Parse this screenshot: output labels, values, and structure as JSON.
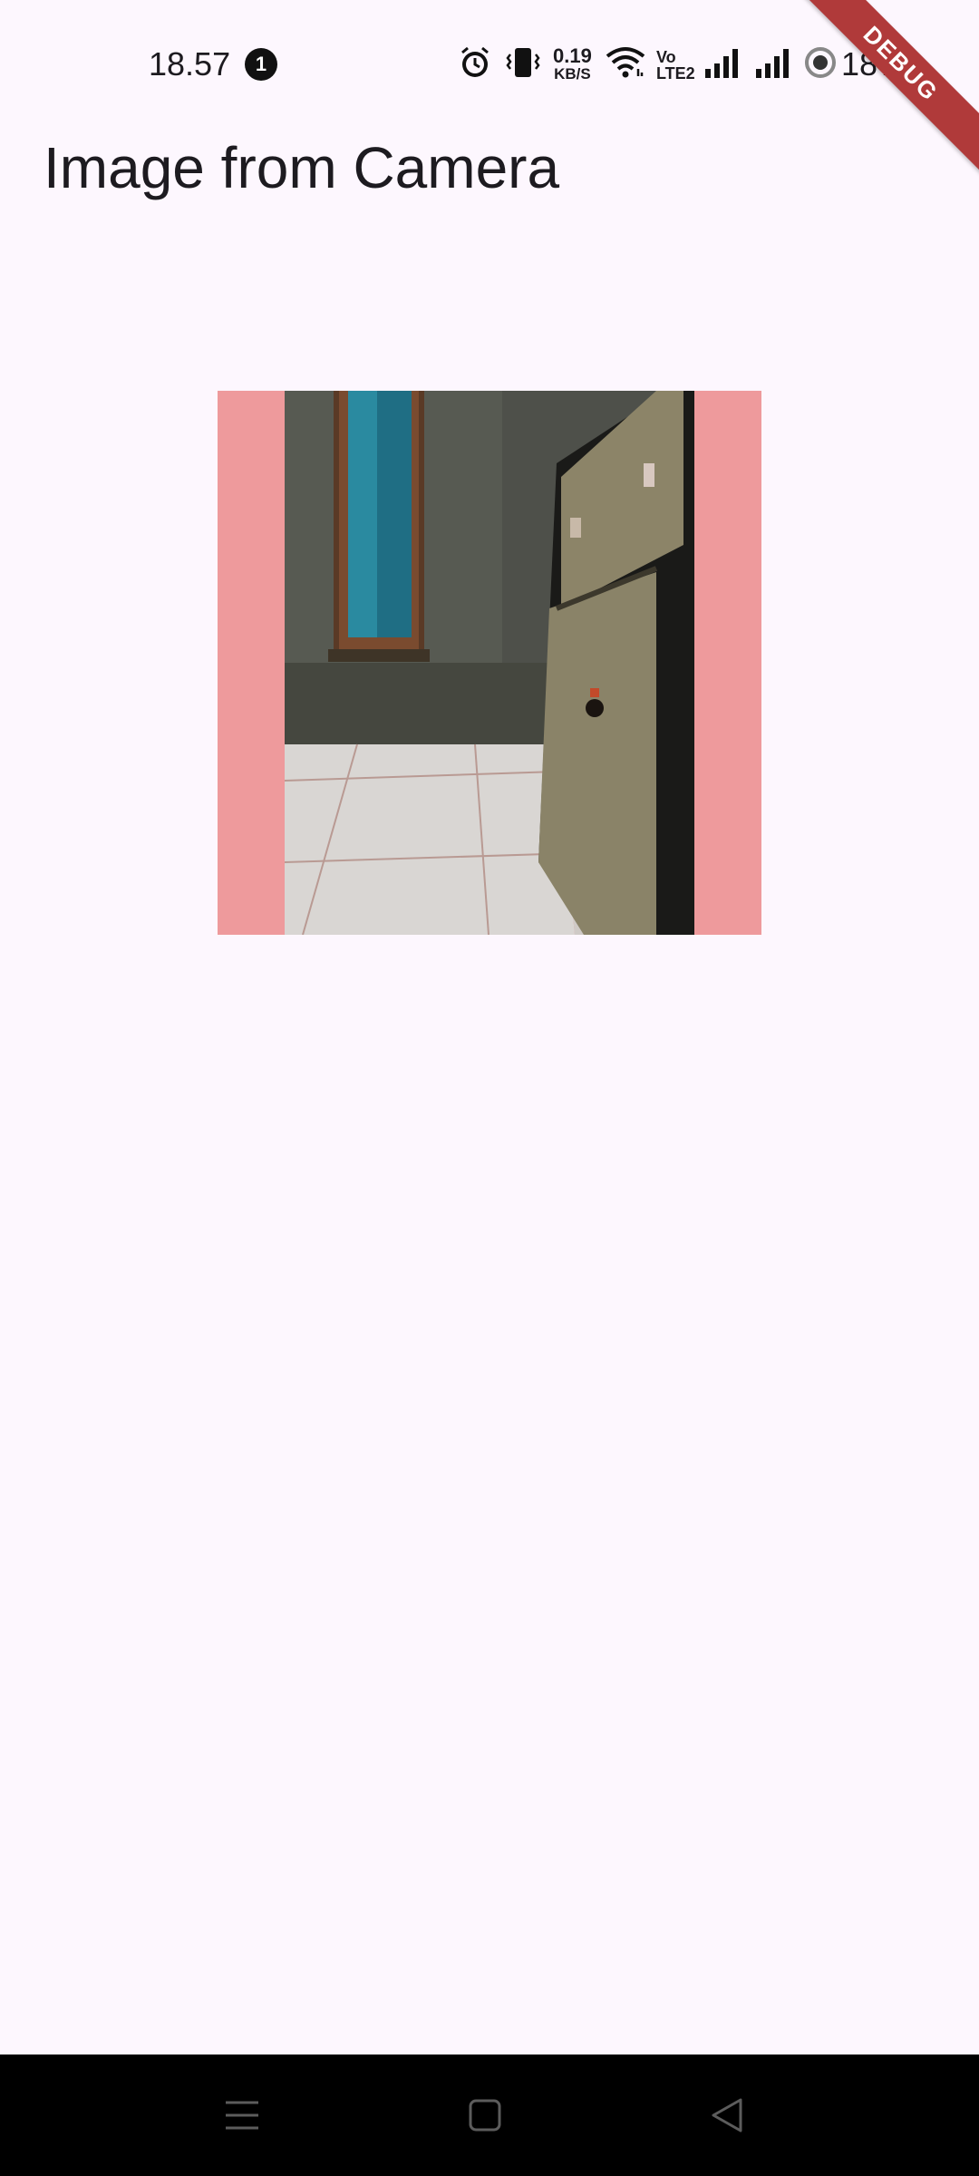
{
  "status_bar": {
    "time": "18.57",
    "notification_count": "1",
    "net_speed_value": "0.19",
    "net_speed_unit": "KB/S",
    "volte_line1": "Vo",
    "volte_line2": "LTE2",
    "battery_percent": "18%",
    "icons": [
      "alarm-icon",
      "vibrate-icon",
      "wifi-icon",
      "signal-icon",
      "signal-icon",
      "battery-saver-icon"
    ]
  },
  "debug_banner": "DEBUG",
  "app_bar": {
    "title": "Image from Camera"
  },
  "image": {
    "background_color": "#ee9a9c"
  },
  "nav_bar": {
    "buttons": [
      "menu-icon",
      "home-icon",
      "back-icon"
    ]
  }
}
